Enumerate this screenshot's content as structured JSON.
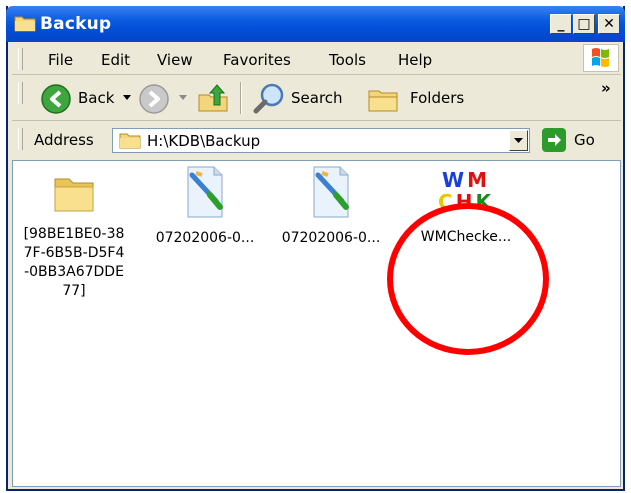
{
  "window": {
    "title": "Backup"
  },
  "menu": [
    "File",
    "Edit",
    "View",
    "Favorites",
    "Tools",
    "Help"
  ],
  "toolbar": {
    "back_label": "Back",
    "search_label": "Search",
    "folders_label": "Folders",
    "chevron": "»"
  },
  "address": {
    "label": "Address",
    "value": "H:\\KDB\\Backup",
    "go_label": "Go"
  },
  "files": [
    {
      "name_lines": [
        "[98BE1BE0-38",
        "7F-6B5B-D5F4",
        "-0BB3A67DDE",
        "77]"
      ],
      "icon": "folder-icon"
    },
    {
      "name": "07202006-0...",
      "icon": "paint-file-icon"
    },
    {
      "name": "07202006-0...",
      "icon": "paint-file-icon"
    },
    {
      "name": "WMChecke...",
      "icon": "wmchk-icon",
      "icon_text_top": "WM",
      "icon_text_bottom": "CHK"
    }
  ],
  "colors": {
    "title_blue": "#0a5be0",
    "highlight_circle": "#ff0000"
  }
}
